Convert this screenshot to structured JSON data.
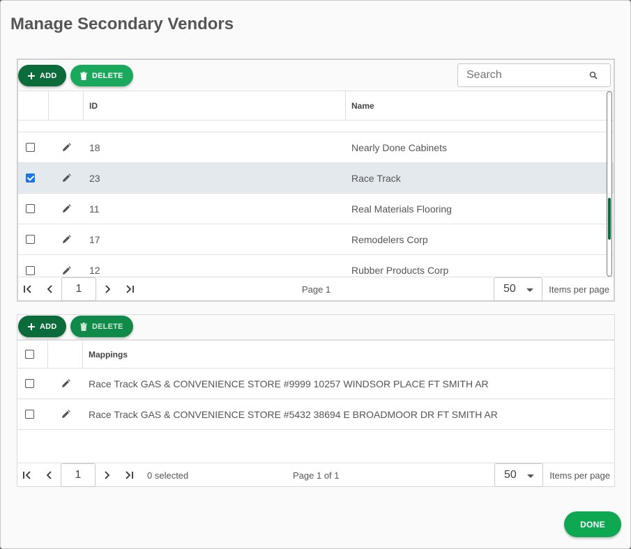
{
  "dialog": {
    "title": "Manage Secondary Vendors",
    "done_label": "DONE"
  },
  "vendors_grid": {
    "add_label": "ADD",
    "delete_label": "DELETE",
    "search_placeholder": "Search",
    "columns": {
      "id": "ID",
      "name": "Name"
    },
    "rows": [
      {
        "id": "18",
        "name": "Nearly Done Cabinets",
        "checked": false
      },
      {
        "id": "23",
        "name": "Race Track",
        "checked": true
      },
      {
        "id": "11",
        "name": "Real Materials Flooring",
        "checked": false
      },
      {
        "id": "17",
        "name": "Remodelers Corp",
        "checked": false
      },
      {
        "id": "12",
        "name": "Rubber Products Corp",
        "checked": false
      }
    ],
    "pager": {
      "page_value": "1",
      "page_label": "Page 1",
      "per_page": "50",
      "per_page_label": "Items per page"
    }
  },
  "mappings_grid": {
    "add_label": "ADD",
    "delete_label": "DELETE",
    "columns": {
      "mappings": "Mappings"
    },
    "rows": [
      {
        "mapping": "Race Track GAS & CONVENIENCE STORE #9999 10257 WINDSOR PLACE FT SMITH AR",
        "checked": false
      },
      {
        "mapping": "Race Track GAS & CONVENIENCE STORE #5432 38694 E BROADMOOR DR FT SMITH AR",
        "checked": false
      }
    ],
    "pager": {
      "page_value": "1",
      "selected_label": "0 selected",
      "page_label": "Page 1 of 1",
      "per_page": "50",
      "per_page_label": "Items per page"
    }
  },
  "colors": {
    "primary_dark": "#0b6b3a",
    "primary": "#1aa85c",
    "done": "#0da851",
    "selected_row": "#e3e9ec",
    "checkbox": "#1a73e8"
  }
}
